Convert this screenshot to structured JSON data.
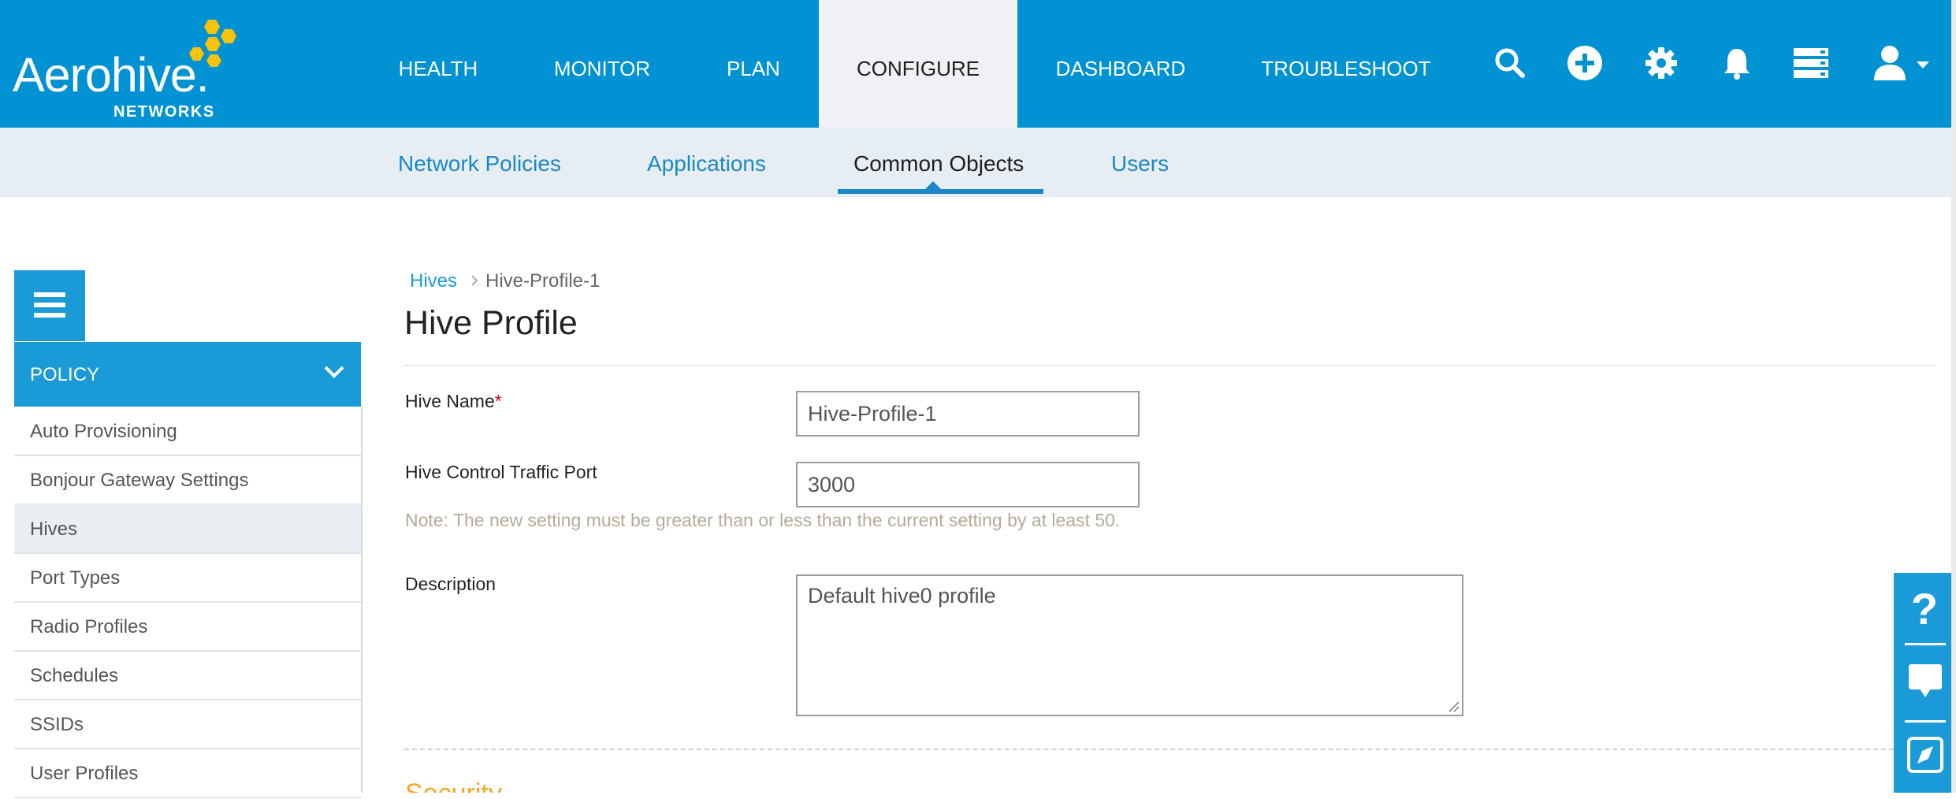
{
  "app": {
    "logo_text": "Aerohive.",
    "logo_subtext": "NETWORKS"
  },
  "topnav": {
    "items": [
      {
        "label": "HEALTH"
      },
      {
        "label": "MONITOR"
      },
      {
        "label": "PLAN"
      },
      {
        "label": "CONFIGURE",
        "active": true
      },
      {
        "label": "DASHBOARD"
      },
      {
        "label": "TROUBLESHOOT"
      }
    ],
    "icons": [
      "search-icon",
      "add-circle-icon",
      "gear-icon",
      "bell-icon",
      "server-icon",
      "user-icon"
    ]
  },
  "subnav": {
    "items": [
      {
        "label": "Network Policies"
      },
      {
        "label": "Applications"
      },
      {
        "label": "Common Objects",
        "active": true
      },
      {
        "label": "Users"
      }
    ]
  },
  "sidebar": {
    "menu_icon": "hamburger-icon",
    "section_label": "POLICY",
    "items": [
      {
        "label": "Auto Provisioning"
      },
      {
        "label": "Bonjour Gateway Settings"
      },
      {
        "label": "Hives",
        "active": true
      },
      {
        "label": "Port Types"
      },
      {
        "label": "Radio Profiles"
      },
      {
        "label": "Schedules"
      },
      {
        "label": "SSIDs"
      },
      {
        "label": "User Profiles"
      }
    ]
  },
  "breadcrumb": {
    "parent": "Hives",
    "current": "Hive-Profile-1"
  },
  "page": {
    "title": "Hive Profile",
    "next_section_title": "Security"
  },
  "form": {
    "hive_name_label": "Hive Name",
    "hive_name_required_mark": "*",
    "hive_name_value": "Hive-Profile-1",
    "port_label": "Hive Control Traffic Port",
    "port_value": "3000",
    "port_note": "Note: The new setting must be greater than or less than the current setting by at least 50.",
    "description_label": "Description",
    "description_value": "Default hive0 profile"
  },
  "help_tabs": {
    "icons": [
      "help-question-icon",
      "chat-bubble-icon",
      "compass-icon"
    ]
  },
  "colors": {
    "brand_blue": "#0092d3",
    "link_blue": "#1a88c6",
    "subnav_bg": "#e7eef3",
    "logo_hex_yellow": "#f8c10a",
    "section_orange": "#f5a623",
    "required_red": "#d0021b"
  }
}
